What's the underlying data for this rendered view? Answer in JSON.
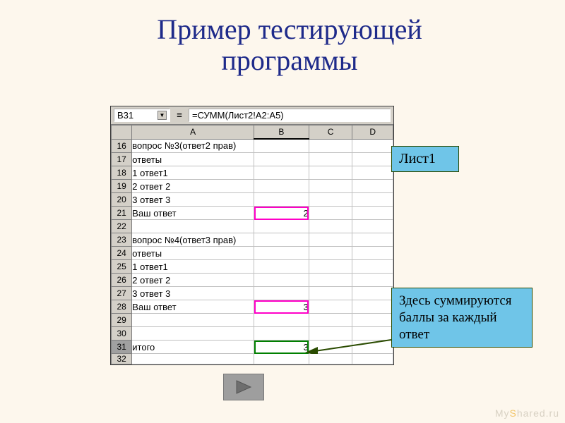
{
  "title": "Пример тестирующей программы",
  "callouts": {
    "sheet_label": "Лист1",
    "sum_note": "Здесь суммируются баллы за каждый ответ"
  },
  "excel": {
    "namebox": "B31",
    "formula": "=СУММ(Лист2!A2:A5)",
    "columns": {
      "A": "A",
      "B": "B",
      "C": "C",
      "D": "D"
    },
    "rows": [
      {
        "n": "16",
        "A": "вопрос №3(ответ2 прав)",
        "B": ""
      },
      {
        "n": "17",
        "A": "ответы",
        "B": ""
      },
      {
        "n": "18",
        "A": "1 ответ1",
        "B": ""
      },
      {
        "n": "19",
        "A": "2 ответ 2",
        "B": ""
      },
      {
        "n": "20",
        "A": "3 ответ 3",
        "B": ""
      },
      {
        "n": "21",
        "A": "Ваш ответ",
        "B": "2",
        "hlB": "pink",
        "numB": true
      },
      {
        "n": "22",
        "A": "",
        "B": ""
      },
      {
        "n": "23",
        "A": "вопрос №4(ответ3 прав)",
        "B": ""
      },
      {
        "n": "24",
        "A": "ответы",
        "B": ""
      },
      {
        "n": "25",
        "A": "1 ответ1",
        "B": ""
      },
      {
        "n": "26",
        "A": "2 ответ 2",
        "B": ""
      },
      {
        "n": "27",
        "A": "3 ответ 3",
        "B": ""
      },
      {
        "n": "28",
        "A": "Ваш ответ",
        "B": "3",
        "hlB": "pink",
        "numB": true
      },
      {
        "n": "29",
        "A": "",
        "B": ""
      },
      {
        "n": "30",
        "A": "",
        "B": ""
      },
      {
        "n": "31",
        "A": "итого",
        "B": "3",
        "hlB": "green",
        "numB": true,
        "sel": true
      }
    ],
    "cutoff_row": "32"
  },
  "watermark": {
    "pre": "My",
    "mid": "S",
    "post": "hared.ru"
  }
}
